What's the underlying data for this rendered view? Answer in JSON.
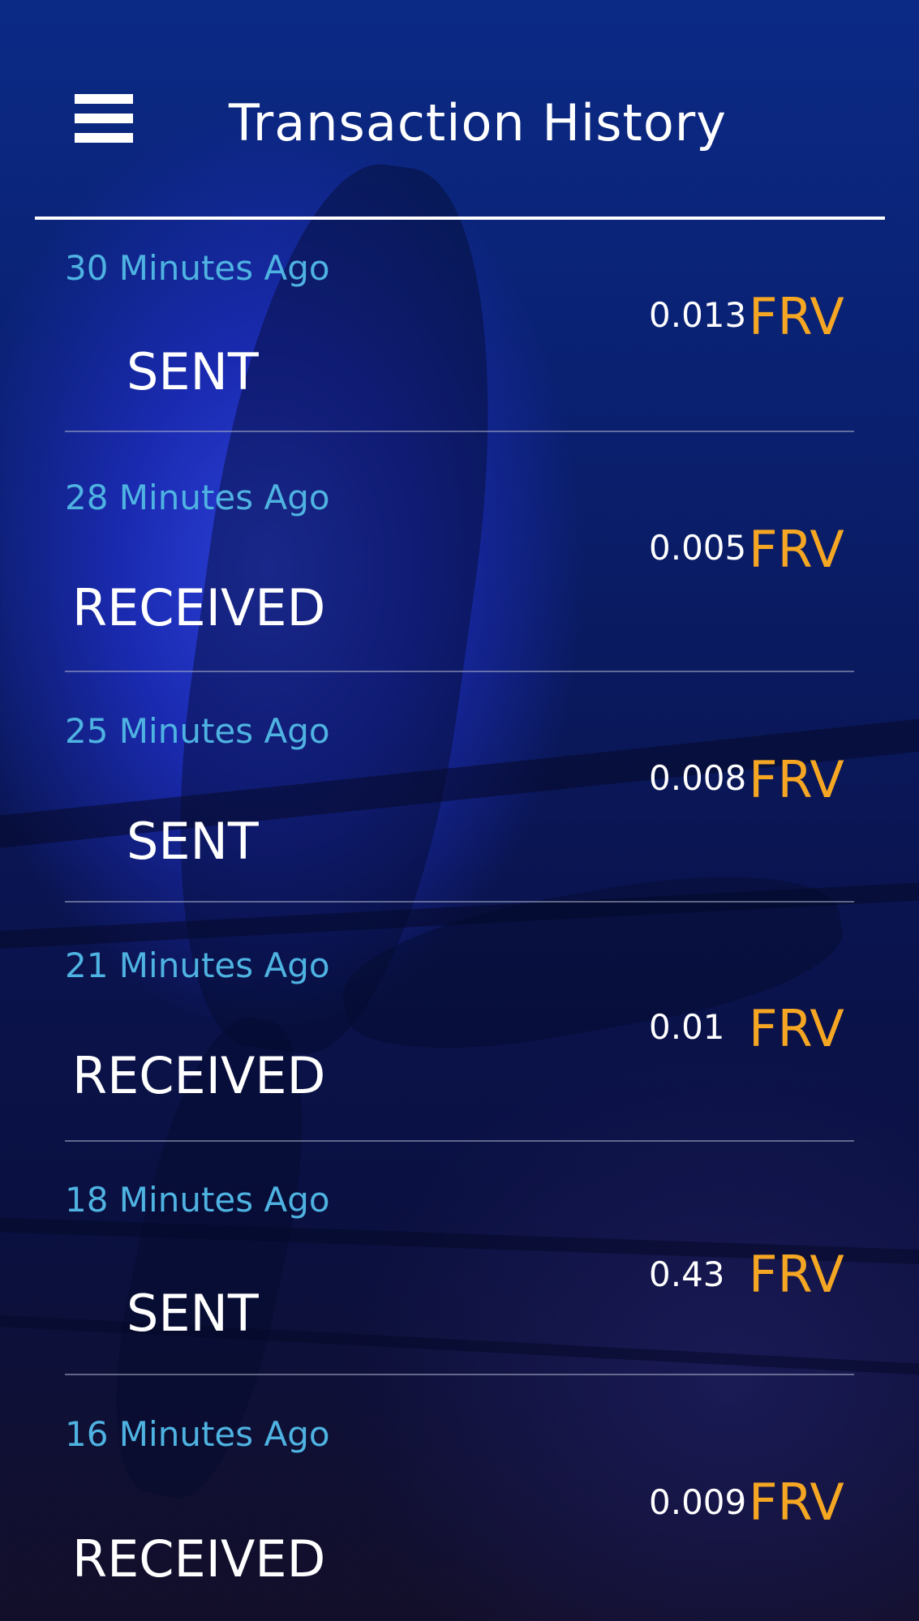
{
  "header": {
    "title": "Transaction History",
    "menu_icon": "hamburger-menu-icon"
  },
  "transactions": [
    {
      "time": "30 Minutes Ago",
      "type": "SENT",
      "amount": "0.013",
      "currency": "FRV"
    },
    {
      "time": "28 Minutes Ago",
      "type": "RECEIVED",
      "amount": "0.005",
      "currency": "FRV"
    },
    {
      "time": "25 Minutes Ago",
      "type": "SENT",
      "amount": "0.008",
      "currency": "FRV"
    },
    {
      "time": "21 Minutes Ago",
      "type": "RECEIVED",
      "amount": "0.01",
      "currency": "FRV"
    },
    {
      "time": "18 Minutes Ago",
      "type": "SENT",
      "amount": "0.43",
      "currency": "FRV"
    },
    {
      "time": "16 Minutes Ago",
      "type": "RECEIVED",
      "amount": "0.009",
      "currency": "FRV"
    }
  ],
  "colors": {
    "time_text": "#4fb3e2",
    "currency_text": "#f5a623",
    "primary_text": "#ffffff",
    "background": "#0a1a6e"
  }
}
